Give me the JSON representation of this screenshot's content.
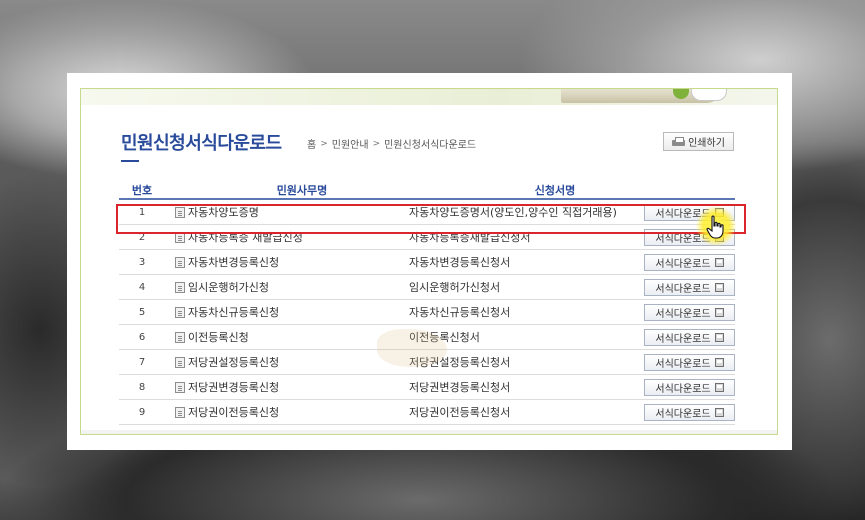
{
  "page": {
    "title": "민원신청서식다운로드",
    "print_label": "인쇄하기"
  },
  "breadcrumb": {
    "home": "홈",
    "level1": "민원안내",
    "level2": "민원신청서식다운로드"
  },
  "table": {
    "headers": {
      "number": "번호",
      "office": "민원사무명",
      "form": "신청서명"
    },
    "button_label": "서식다운로드",
    "rows": [
      {
        "num": "1",
        "office": "자동차양도증명",
        "form": "자동차양도증명서(양도인,양수인 직접거래용)"
      },
      {
        "num": "2",
        "office": "자동차등록증 재발급신청",
        "form": "자동차등록증재발급신청서"
      },
      {
        "num": "3",
        "office": "자동차변경등록신청",
        "form": "자동차변경등록신청서"
      },
      {
        "num": "4",
        "office": "임시운행허가신청",
        "form": "임시운행허가신청서"
      },
      {
        "num": "5",
        "office": "자동차신규등록신청",
        "form": "자동차신규등록신청서"
      },
      {
        "num": "6",
        "office": "이전등록신청",
        "form": "이전등록신청서"
      },
      {
        "num": "7",
        "office": "저당권설정등록신청",
        "form": "저당권설정등록신청서"
      },
      {
        "num": "8",
        "office": "저당권변경등록신청",
        "form": "저당권변경등록신청서"
      },
      {
        "num": "9",
        "office": "저당권이전등록신청",
        "form": "저당권이전등록신청서"
      }
    ]
  },
  "colors": {
    "title_blue": "#2a4b9b",
    "highlight_red": "#d8262c",
    "cursor_yellow": "#fff050"
  }
}
